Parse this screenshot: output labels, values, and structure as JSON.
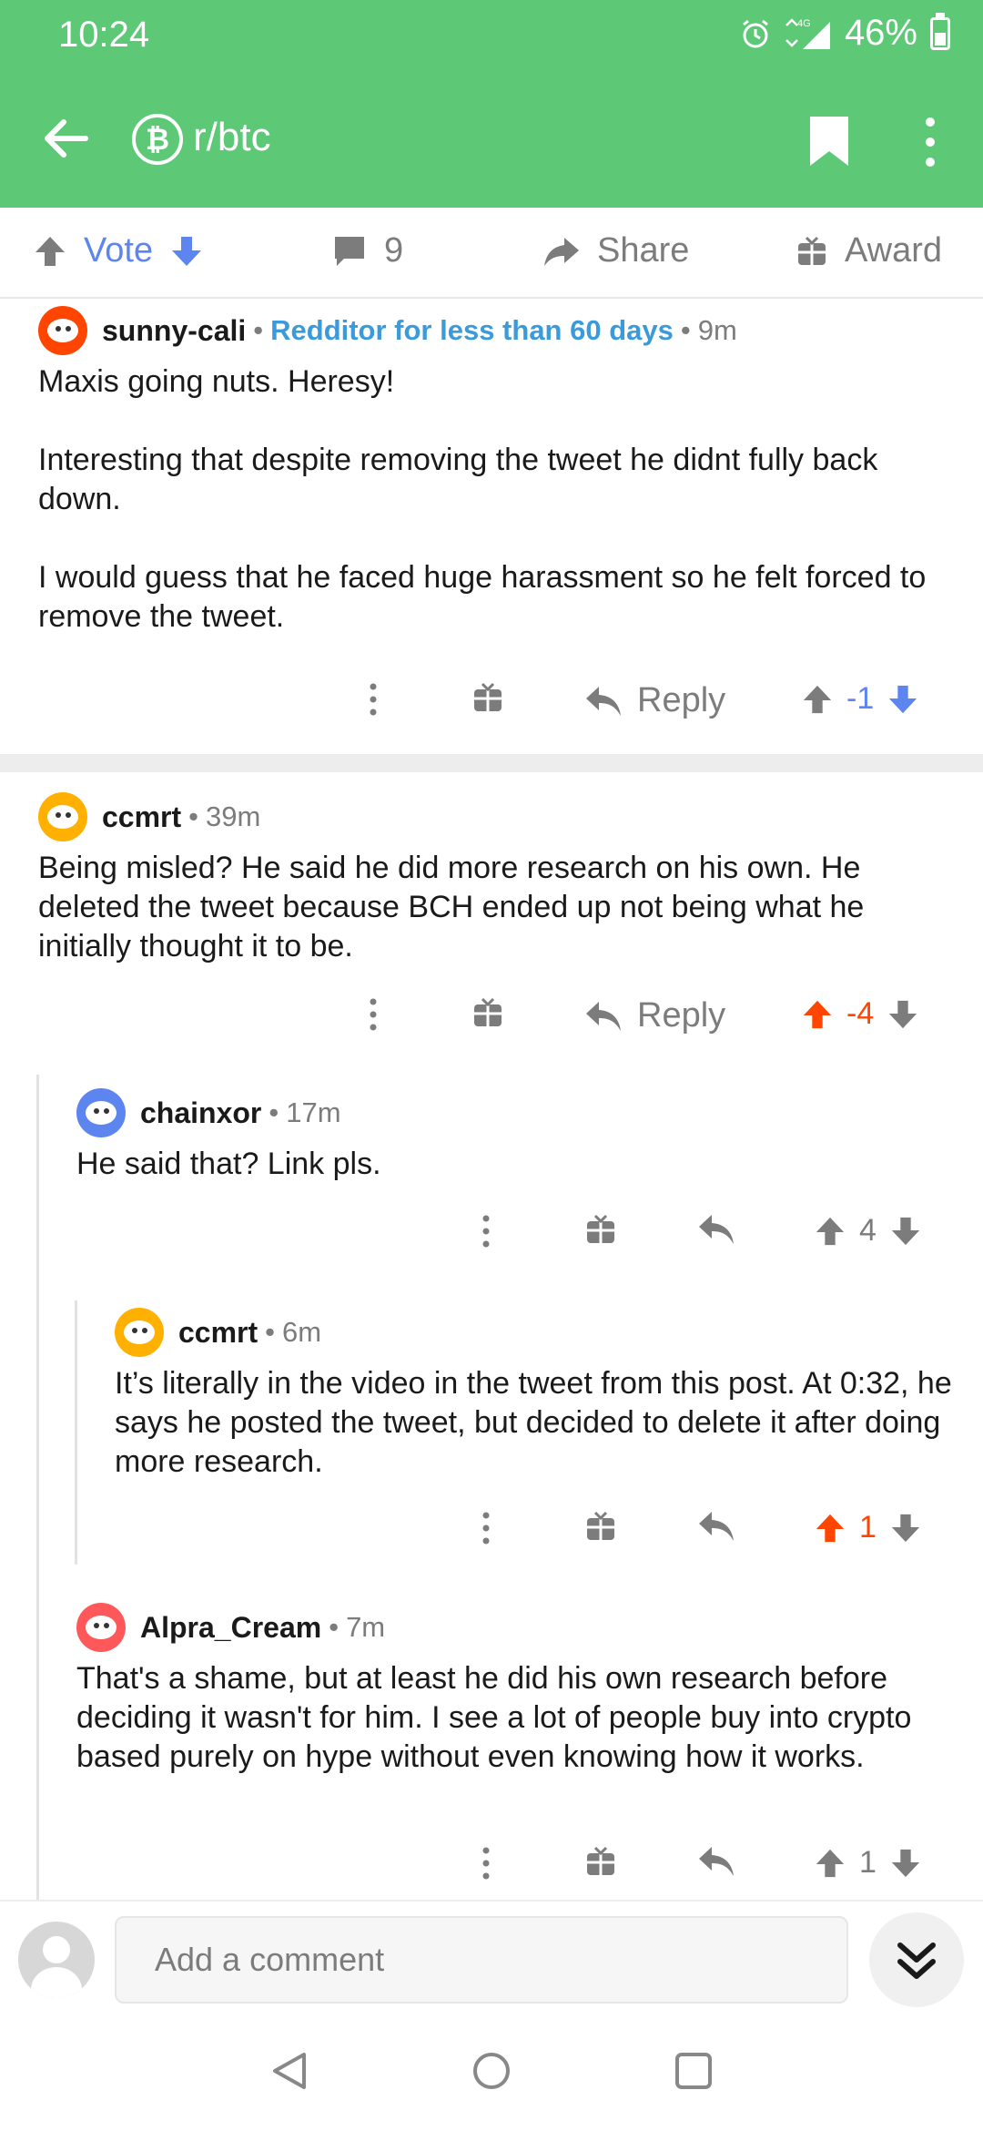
{
  "status": {
    "time": "10:24",
    "battery": "46%",
    "network": "4G",
    "battery_level": 0.46
  },
  "header": {
    "subreddit": "r/btc",
    "sub_icon_glyph": "₿"
  },
  "post_actions": {
    "vote_label": "Vote",
    "comments_count": "9",
    "share_label": "Share",
    "award_label": "Award"
  },
  "comments": [
    {
      "username": "sunny-cali",
      "flair": "Redditor for less than 60 days",
      "time": "9m",
      "avatar_color": "#ff4500",
      "paragraphs": [
        "Maxis going nuts. Heresy!",
        "Interesting that despite removing the tweet he didnt fully back down.",
        "I would guess that he faced huge harassment so he felt forced to remove the tweet."
      ],
      "reply_label": "Reply",
      "score": "-1"
    },
    {
      "username": "ccmrt",
      "time": "39m",
      "avatar_color": "#ffb000",
      "paragraphs": [
        "Being misled? He said he did more research on his own. He deleted the tweet because BCH ended up not being what he initially thought it to be."
      ],
      "reply_label": "Reply",
      "score": "-4"
    },
    {
      "username": "chainxor",
      "time": "17m",
      "avatar_color": "#5c85f0",
      "paragraphs": [
        "He said that? Link pls."
      ],
      "score": "4"
    },
    {
      "username": "ccmrt",
      "time": "6m",
      "avatar_color": "#ffb000",
      "paragraphs": [
        "It’s literally in the video in the tweet from this post. At 0:32, he says he posted the tweet, but decided to delete it after doing more research."
      ],
      "score": "1"
    },
    {
      "username": "Alpra_Cream",
      "time": "7m",
      "avatar_color": "#ff585b",
      "paragraphs": [
        "That's a shame, but at least he did his own research before deciding it wasn't for him. I see a lot of people buy into crypto based purely on hype without even knowing how it works."
      ],
      "score": "1"
    }
  ],
  "composer": {
    "placeholder": "Add a comment"
  },
  "colors": {
    "brand_green": "#5dc977",
    "upvote": "#ff4500",
    "downvote": "#5c85f0",
    "flair": "#3b9ad9"
  }
}
